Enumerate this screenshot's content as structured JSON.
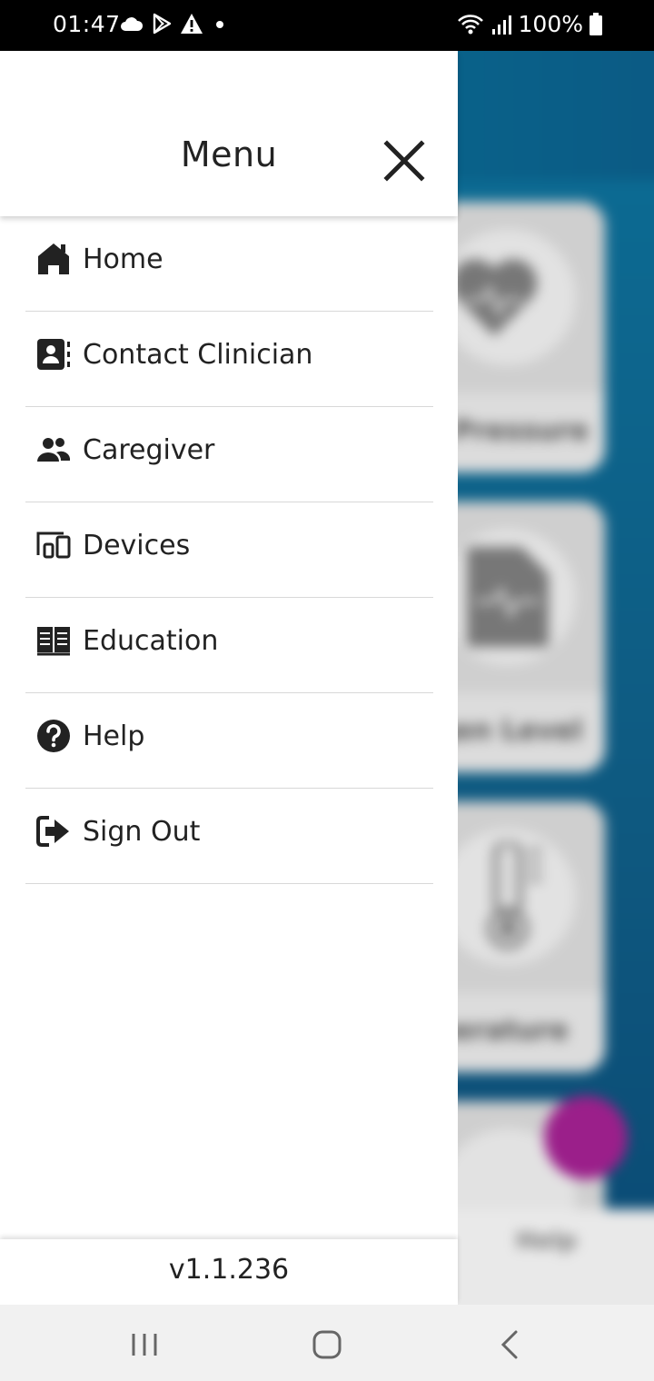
{
  "status_bar": {
    "time": "01:47",
    "battery": "100%",
    "left_icons": [
      "cloud-icon",
      "play-store-icon",
      "warning-icon",
      "dot-icon"
    ],
    "right_icons": [
      "wifi-icon",
      "signal-icon",
      "battery-icon"
    ]
  },
  "drawer": {
    "title": "Menu",
    "items": [
      {
        "label": "Home",
        "icon": "home-icon"
      },
      {
        "label": "Contact Clinician",
        "icon": "contact-card-icon"
      },
      {
        "label": "Caregiver",
        "icon": "people-icon"
      },
      {
        "label": "Devices",
        "icon": "devices-icon"
      },
      {
        "label": "Education",
        "icon": "book-icon"
      },
      {
        "label": "Help",
        "icon": "help-icon"
      },
      {
        "label": "Sign Out",
        "icon": "sign-out-icon"
      }
    ],
    "version": "v1.1.236"
  },
  "background": {
    "cards": [
      "l Pressure",
      "gen Level",
      "perature"
    ],
    "nav_help": "Help",
    "colors": {
      "header": "#09628a",
      "fab": "#9b1f8a"
    }
  },
  "nav_bar": {
    "buttons": [
      "recent-apps-icon",
      "home-button-icon",
      "back-icon"
    ]
  }
}
